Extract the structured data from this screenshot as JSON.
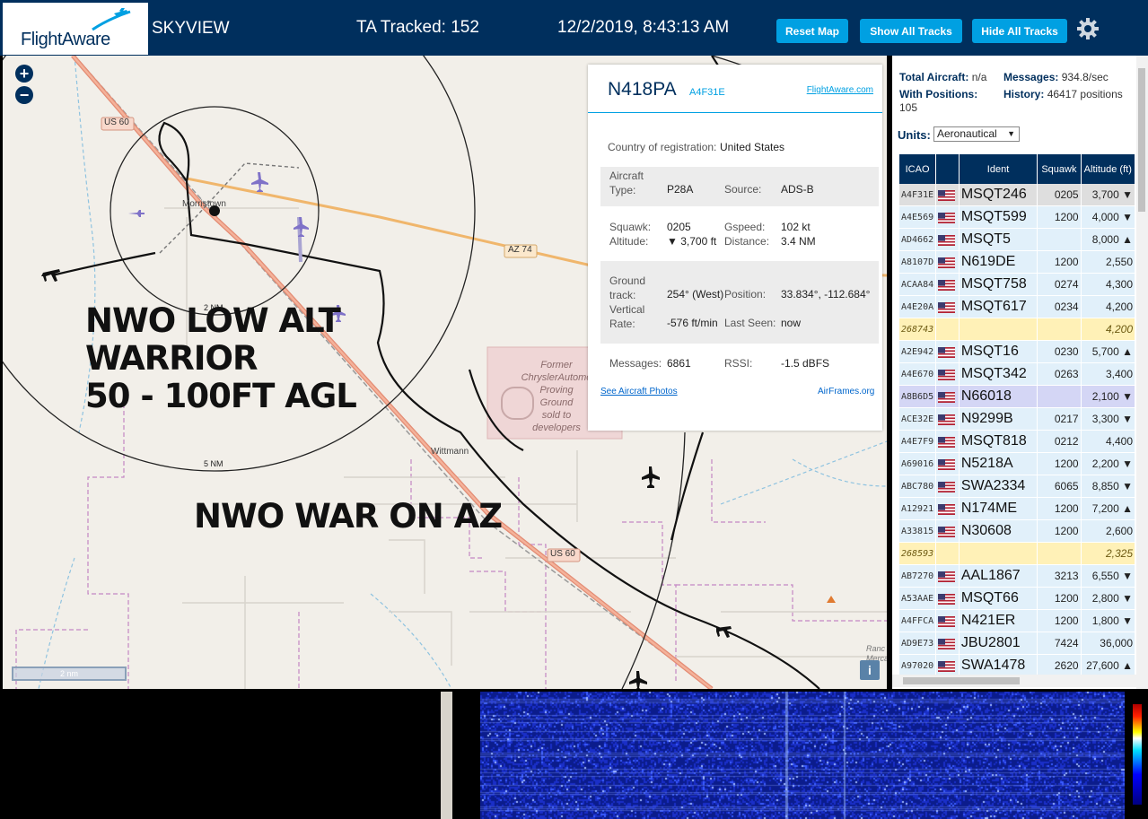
{
  "header": {
    "logo": "FlightAware",
    "site_name": "SKYVIEW",
    "ta_tracked": "TA Tracked: 152",
    "datetime": "12/2/2019, 8:43:13 AM",
    "buttons": {
      "reset_map": "Reset Map",
      "show_all": "Show All Tracks",
      "hide_all": "Hide All Tracks"
    },
    "settings_icon": "gear-icon",
    "brand_color": "#002f5d",
    "accent_color": "#00a0e2"
  },
  "map": {
    "zoom_in": "+",
    "zoom_out": "−",
    "labels": {
      "us60_top": "US 60",
      "us60_bottom": "US 60",
      "az74": "AZ 74",
      "morristown": "Morristown",
      "wittmann": "Wittmann",
      "ring_2nm": "2 NM",
      "ring_5nm": "5 NM",
      "former_area": [
        "Former",
        "ChryslerAutomo",
        "Proving",
        "Ground",
        "sold to",
        "developers"
      ],
      "rancho": [
        "Ranc",
        "Merca"
      ]
    },
    "overlay_text": {
      "line1": "NWO LOW ALT",
      "line2": "WARRIOR",
      "line3": "50 - 100FT AGL",
      "line4": "NWO WAR ON AZ"
    },
    "scale_label": "2 nm",
    "info_button": "i"
  },
  "selected_plane": {
    "callsign": "N418PA",
    "icao": "A4F31E",
    "flightaware_link": "FlightAware.com",
    "country_label": "Country of registration:",
    "country": "United States",
    "aircraft_type_label": "Aircraft Type:",
    "aircraft_type": "P28A",
    "source_label": "Source:",
    "source": "ADS-B",
    "squawk_label": "Squawk:",
    "squawk": "0205",
    "altitude_label": "Altitude:",
    "altitude": "▼ 3,700 ft",
    "gspeed_label": "Gspeed:",
    "gspeed": "102 kt",
    "distance_label": "Distance:",
    "distance": "3.4 NM",
    "ground_track_label": "Ground track:",
    "ground_track": "254° (West)",
    "position_label": "Position:",
    "position": "33.834°, -112.684°",
    "vertical_rate_label": "Vertical Rate:",
    "vertical_rate": "-576 ft/min",
    "last_seen_label": "Last Seen:",
    "last_seen": "now",
    "messages_label": "Messages:",
    "messages": "6861",
    "rssi_label": "RSSI:",
    "rssi": "-1.5 dBFS",
    "photos_link": "See Aircraft Photos",
    "airframes_link": "AirFrames.org"
  },
  "sidebar": {
    "total_aircraft_label": "Total Aircraft:",
    "total_aircraft": "n/a",
    "messages_label": "Messages:",
    "messages": "934.8/sec",
    "with_positions_label": "With Positions:",
    "with_positions": "105",
    "history_label": "History:",
    "history": "46417 positions",
    "units_label": "Units:",
    "units_value": "Aeronautical",
    "columns": {
      "icao": "ICAO",
      "flag": "",
      "ident": "Ident",
      "squawk": "Squawk",
      "altitude": "Altitude (ft)"
    },
    "rows": [
      {
        "icao": "A4F31E",
        "flag": true,
        "ident": "MSQT246",
        "squawk": "0205",
        "altitude": "3,700 ▼",
        "state": "current"
      },
      {
        "icao": "A4E569",
        "flag": true,
        "ident": "MSQT599",
        "squawk": "1200",
        "altitude": "4,000 ▼",
        "state": ""
      },
      {
        "icao": "AD4662",
        "flag": true,
        "ident": "MSQT5",
        "squawk": "",
        "altitude": "8,000 ▲",
        "state": ""
      },
      {
        "icao": "A8107D",
        "flag": true,
        "ident": "N619DE",
        "squawk": "1200",
        "altitude": "2,550",
        "state": ""
      },
      {
        "icao": "ACAA84",
        "flag": true,
        "ident": "MSQT758",
        "squawk": "0274",
        "altitude": "4,300",
        "state": ""
      },
      {
        "icao": "A4E20A",
        "flag": true,
        "ident": "MSQT617",
        "squawk": "0234",
        "altitude": "4,200",
        "state": ""
      },
      {
        "icao": "268743",
        "flag": false,
        "ident": "",
        "squawk": "",
        "altitude": "4,200",
        "state": "nopos"
      },
      {
        "icao": "A2E942",
        "flag": true,
        "ident": "MSQT16",
        "squawk": "0230",
        "altitude": "5,700 ▲",
        "state": ""
      },
      {
        "icao": "A4E670",
        "flag": true,
        "ident": "MSQT342",
        "squawk": "0263",
        "altitude": "3,400",
        "state": ""
      },
      {
        "icao": "A8B6D5",
        "flag": true,
        "ident": "N66018",
        "squawk": "",
        "altitude": "2,100 ▼",
        "state": "sel"
      },
      {
        "icao": "ACE32E",
        "flag": true,
        "ident": "N9299B",
        "squawk": "0217",
        "altitude": "3,300 ▼",
        "state": ""
      },
      {
        "icao": "A4E7F9",
        "flag": true,
        "ident": "MSQT818",
        "squawk": "0212",
        "altitude": "4,400",
        "state": ""
      },
      {
        "icao": "A69016",
        "flag": true,
        "ident": "N5218A",
        "squawk": "1200",
        "altitude": "2,200 ▼",
        "state": ""
      },
      {
        "icao": "ABC780",
        "flag": true,
        "ident": "SWA2334",
        "squawk": "6065",
        "altitude": "8,850 ▼",
        "state": ""
      },
      {
        "icao": "A12921",
        "flag": true,
        "ident": "N174ME",
        "squawk": "1200",
        "altitude": "7,200 ▲",
        "state": ""
      },
      {
        "icao": "A33815",
        "flag": true,
        "ident": "N30608",
        "squawk": "1200",
        "altitude": "2,600",
        "state": ""
      },
      {
        "icao": "268593",
        "flag": false,
        "ident": "",
        "squawk": "",
        "altitude": "2,325",
        "state": "nopos"
      },
      {
        "icao": "AB7270",
        "flag": true,
        "ident": "AAL1867",
        "squawk": "3213",
        "altitude": "6,550 ▼",
        "state": ""
      },
      {
        "icao": "A53AAE",
        "flag": true,
        "ident": "MSQT66",
        "squawk": "1200",
        "altitude": "2,800 ▼",
        "state": ""
      },
      {
        "icao": "A4FFCA",
        "flag": true,
        "ident": "N421ER",
        "squawk": "1200",
        "altitude": "1,800 ▼",
        "state": ""
      },
      {
        "icao": "AD9E73",
        "flag": true,
        "ident": "JBU2801",
        "squawk": "7424",
        "altitude": "36,000",
        "state": ""
      },
      {
        "icao": "A97020",
        "flag": true,
        "ident": "SWA1478",
        "squawk": "2620",
        "altitude": "27,600 ▲",
        "state": ""
      }
    ]
  }
}
